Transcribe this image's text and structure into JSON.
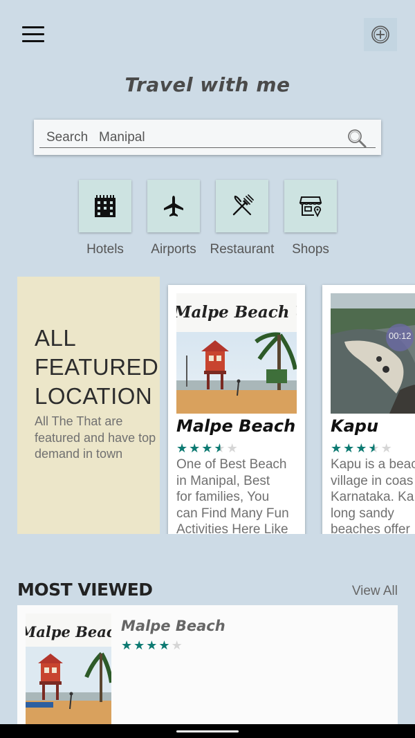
{
  "header": {
    "title": "Travel with me"
  },
  "search": {
    "placeholder": "Search   Manipal",
    "value": ""
  },
  "categories": [
    {
      "label": "Hotels",
      "icon": "hotel-icon"
    },
    {
      "label": "Airports",
      "icon": "airplane-icon"
    },
    {
      "label": "Restaurant",
      "icon": "restaurant-icon"
    },
    {
      "label": "Shops",
      "icon": "shop-icon"
    }
  ],
  "featured": {
    "title_lines": [
      "ALL",
      "FEATURED",
      "LOCATION"
    ],
    "subtitle": "All The That are featured and have top demand in town",
    "cards": [
      {
        "image_caption": "Malpe Beach Udupi",
        "name": "Malpe Beach",
        "rating": 3.5,
        "stars": "★★★★★",
        "desc_lines": [
          "One of Best Beach",
          "in Manipal, Best",
          "for families, You",
          "can Find Many Fun",
          "Activities Here Like"
        ]
      },
      {
        "image_caption": "",
        "video_badge": "00:12",
        "name": "Kapu",
        "rating": 3.5,
        "stars": "★★★★★",
        "desc_lines": [
          "Kapu is a beac",
          "village in coas",
          "Karnataka. Ka",
          "long sandy",
          "beaches offer"
        ]
      }
    ]
  },
  "most_viewed": {
    "title": "MOST VIEWED",
    "view_all": "View All",
    "items": [
      {
        "image_caption": "Malpe Beach Udupi",
        "name": "Malpe Beach",
        "rating": 4,
        "stars": "★★★★★"
      }
    ]
  },
  "colors": {
    "background": "#cddbe6",
    "accent_teal": "#0d7a72",
    "featured_panel": "#ece6c9",
    "category_tile": "#cde3e1"
  }
}
